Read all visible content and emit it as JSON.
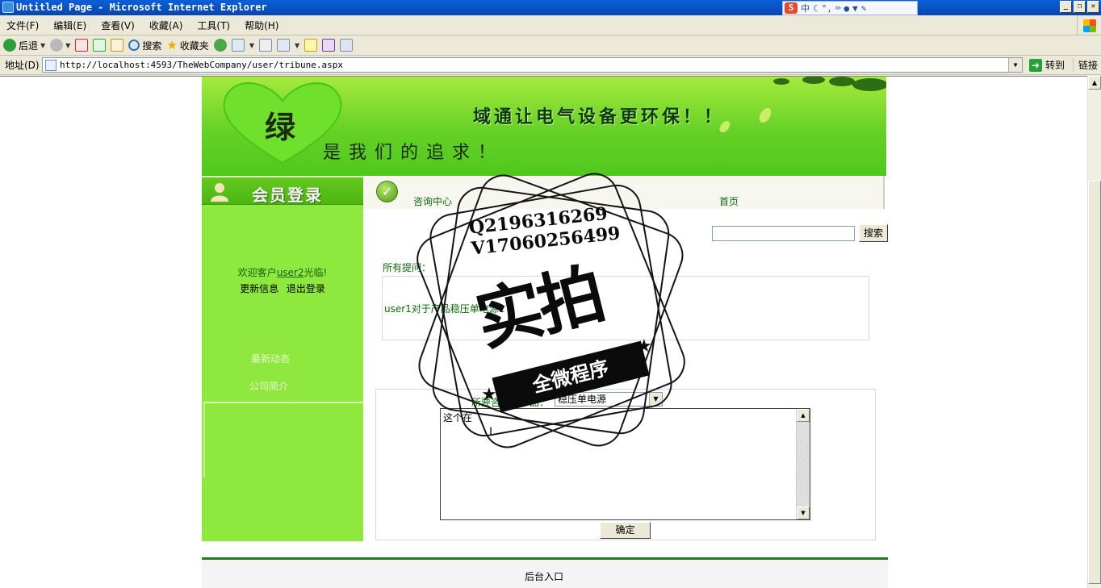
{
  "window": {
    "title": "Untitled Page - Microsoft Internet Explorer",
    "ime_lang": "中"
  },
  "menu": [
    "文件(F)",
    "编辑(E)",
    "查看(V)",
    "收藏(A)",
    "工具(T)",
    "帮助(H)"
  ],
  "toolbar": {
    "back": "后退",
    "search": "搜索",
    "favorites": "收藏夹"
  },
  "address": {
    "label": "地址(D)",
    "url": "http://localhost:4593/TheWebCompany/user/tribune.aspx",
    "go": "转到",
    "links": "链接"
  },
  "banner": {
    "logo": "绿",
    "slogan_top": "域通让电气设备更环保！！",
    "slogan_bottom": "是我们的追求！"
  },
  "sidebar": {
    "title": "会员登录",
    "welcome_prefix": "欢迎客户",
    "username": "user2",
    "welcome_suffix": "光临!",
    "update_info": "更新信息",
    "logout": "退出登录",
    "nav_news": "最新动态",
    "nav_about": "公司简介"
  },
  "nav": {
    "consult": "咨询中心",
    "home": "首页"
  },
  "search": {
    "value": "",
    "button": "搜索"
  },
  "questions": {
    "heading": "所有提问：",
    "items": [
      {
        "text": "user1对于产品稳压单电源1"
      }
    ]
  },
  "form": {
    "product_label": "所要咨询的产品：",
    "product_selected": "稳压单电源",
    "question_text": "这个在",
    "submit": "确定"
  },
  "footer": {
    "admin_link": "后台入口"
  },
  "watermark": {
    "contact_q": "Q2196316269",
    "contact_v": "V17060256499",
    "big_text": "实拍",
    "ribbon": "全微程序"
  },
  "colors": {
    "sidebar_green": "#8ee83d",
    "link_green": "#0b6b0b",
    "footer_line": "#1e7d1e"
  }
}
